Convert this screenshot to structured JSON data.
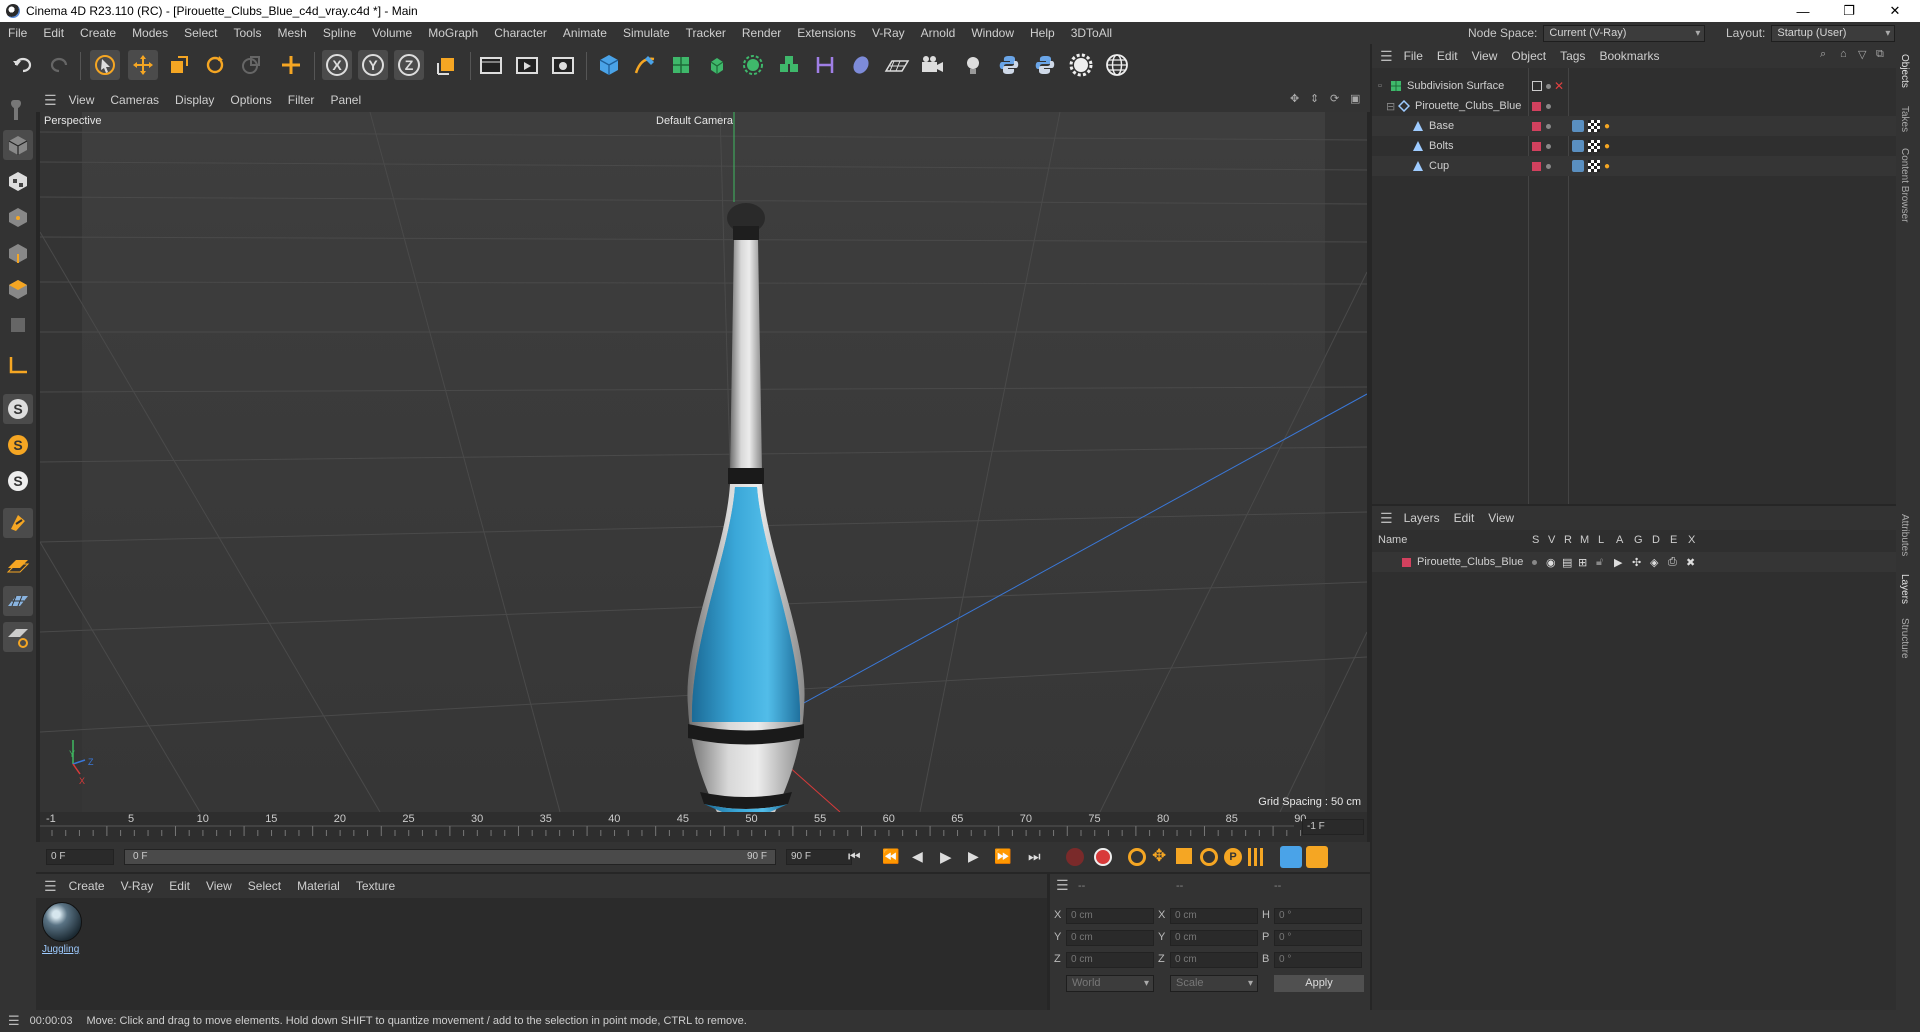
{
  "window": {
    "title": "Cinema 4D R23.110 (RC) - [Pirouette_Clubs_Blue_c4d_vray.c4d *] - Main",
    "minimize": "—",
    "maximize": "❐",
    "close": "✕"
  },
  "menu": {
    "items": [
      "File",
      "Edit",
      "Create",
      "Modes",
      "Select",
      "Tools",
      "Mesh",
      "Spline",
      "Volume",
      "MoGraph",
      "Character",
      "Animate",
      "Simulate",
      "Tracker",
      "Render",
      "Extensions",
      "V-Ray",
      "Arnold",
      "Window",
      "Help",
      "3DToAll"
    ],
    "node_space_label": "Node Space:",
    "node_space_value": "Current (V-Ray)",
    "layout_label": "Layout:",
    "layout_value": "Startup (User)"
  },
  "viewport": {
    "menu": [
      "View",
      "Cameras",
      "Display",
      "Options",
      "Filter",
      "Panel"
    ],
    "label": "Perspective",
    "camera": "Default Camera",
    "grid_spacing": "Grid Spacing : 50 cm",
    "axis_y": "Y",
    "axis_z": "Z",
    "axis_x": "X"
  },
  "timeline": {
    "ticks": [
      "-1",
      "5",
      "10",
      "15",
      "20",
      "25",
      "30",
      "35",
      "40",
      "45",
      "50",
      "55",
      "60",
      "65",
      "70",
      "75",
      "80",
      "85",
      "90"
    ],
    "current_frame_field": "-1 F"
  },
  "transport": {
    "start_field": "0 F",
    "slider_start": "0 F",
    "slider_end": "90 F",
    "end_field": "90 F"
  },
  "materials": {
    "menu": [
      "Create",
      "V-Ray",
      "Edit",
      "View",
      "Select",
      "Material",
      "Texture"
    ],
    "items": [
      {
        "name": "Juggling"
      }
    ]
  },
  "coords": {
    "header": [
      "--",
      "--",
      "--"
    ],
    "rows": [
      {
        "l1": "X",
        "v1": "0 cm",
        "l2": "X",
        "v2": "0 cm",
        "l3": "H",
        "v3": "0 °"
      },
      {
        "l1": "Y",
        "v1": "0 cm",
        "l2": "Y",
        "v2": "0 cm",
        "l3": "P",
        "v3": "0 °"
      },
      {
        "l1": "Z",
        "v1": "0 cm",
        "l2": "Z",
        "v2": "0 cm",
        "l3": "B",
        "v3": "0 °"
      }
    ],
    "mode1": "World",
    "mode2": "Scale",
    "apply": "Apply"
  },
  "status": {
    "time": "00:00:03",
    "message": "Move: Click and drag to move elements. Hold down SHIFT to quantize movement / add to the selection in point mode, CTRL to remove."
  },
  "objects": {
    "menu": [
      "File",
      "Edit",
      "View",
      "Object",
      "Tags",
      "Bookmarks"
    ],
    "tree": [
      {
        "name": "Subdivision Surface",
        "level": 0
      },
      {
        "name": "Pirouette_Clubs_Blue",
        "level": 1
      },
      {
        "name": "Base",
        "level": 2
      },
      {
        "name": "Bolts",
        "level": 2
      },
      {
        "name": "Cup",
        "level": 2
      }
    ]
  },
  "layers": {
    "menu": [
      "Layers",
      "Edit",
      "View"
    ],
    "header_name": "Name",
    "header_cols": [
      "S",
      "V",
      "R",
      "M",
      "L",
      "A",
      "G",
      "D",
      "E",
      "X"
    ],
    "items": [
      {
        "name": "Pirouette_Clubs_Blue",
        "color": "#d2415e"
      }
    ]
  },
  "right_tabs": [
    "Objects",
    "Takes",
    "Content Browser",
    "Attributes",
    "Layers",
    "Structure"
  ],
  "colors": {
    "accent": "#f5a623",
    "layer_red": "#d2415e",
    "club_blue": "#3aa7d8"
  }
}
